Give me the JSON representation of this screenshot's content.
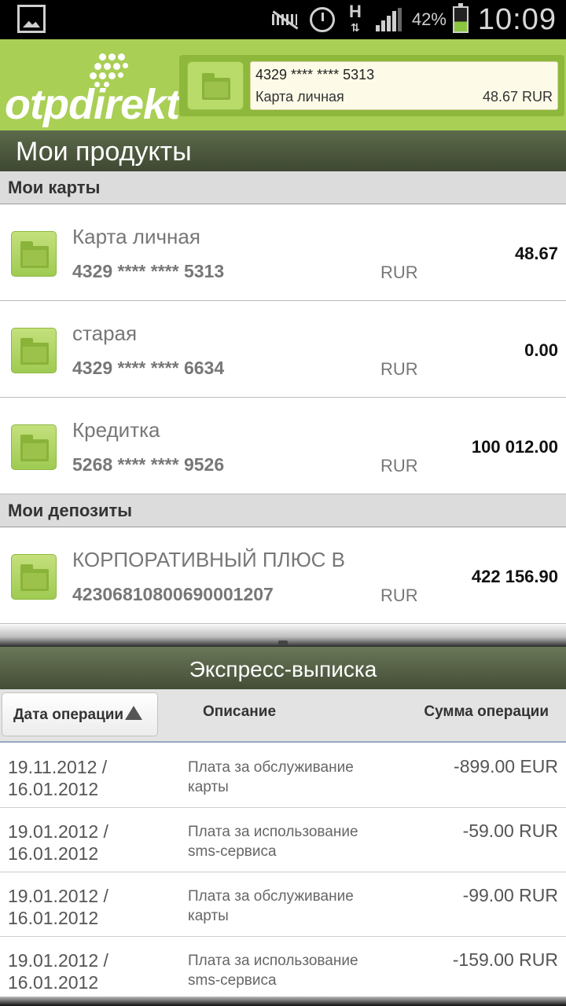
{
  "status_bar": {
    "battery_percent": "42%",
    "time": "10:09",
    "network_label": "H",
    "icons": [
      "gallery-icon",
      "mute-icon",
      "alarm-icon",
      "data-arrows-icon",
      "signal-icon",
      "battery-charging-icon"
    ]
  },
  "header": {
    "logo_text": "otpdirekt",
    "selected_account": {
      "number": "4329 **** **** 5313",
      "name": "Карта личная",
      "balance": "48.67 RUR"
    }
  },
  "page_title": "Мои продукты",
  "sections": {
    "cards_title": "Мои карты",
    "deposits_title": "Мои депозиты"
  },
  "cards": [
    {
      "name": "Карта личная",
      "number": "4329 **** **** 5313",
      "currency": "RUR",
      "balance": "48.67"
    },
    {
      "name": "старая",
      "number": "4329 **** **** 6634",
      "currency": "RUR",
      "balance": "0.00"
    },
    {
      "name": "Кредитка",
      "number": "5268 **** **** 9526",
      "currency": "RUR",
      "balance": "100 012.00"
    }
  ],
  "deposits": [
    {
      "name": "КОРПОРАТИВНЫЙ ПЛЮС В",
      "number": "42306810800690001207",
      "currency": "RUR",
      "balance": "422 156.90"
    }
  ],
  "express": {
    "title": "Экспресс-выписка",
    "col_date": "Дата операции",
    "col_desc": "Описание",
    "col_sum": "Сумма операции",
    "rows": [
      {
        "date1": "19.11.2012 /",
        "date2": "16.01.2012",
        "desc1": "Плата за обслуживание",
        "desc2": "карты",
        "sum": "-899.00 EUR"
      },
      {
        "date1": "19.01.2012 /",
        "date2": "16.01.2012",
        "desc1": "Плата за использование",
        "desc2": "sms-сервиса",
        "sum": "-59.00 RUR"
      },
      {
        "date1": "19.01.2012 /",
        "date2": "16.01.2012",
        "desc1": "Плата за обслуживание",
        "desc2": "карты",
        "sum": "-99.00 RUR"
      },
      {
        "date1": "19.01.2012 /",
        "date2": "16.01.2012",
        "desc1": "Плата за использование",
        "desc2": "sms-сервиса",
        "sum": "-159.00 RUR"
      }
    ]
  },
  "colors": {
    "brand_green": "#a9cf55",
    "title_bar": "#4e5a3f",
    "section_gray": "#dcdcdc"
  }
}
